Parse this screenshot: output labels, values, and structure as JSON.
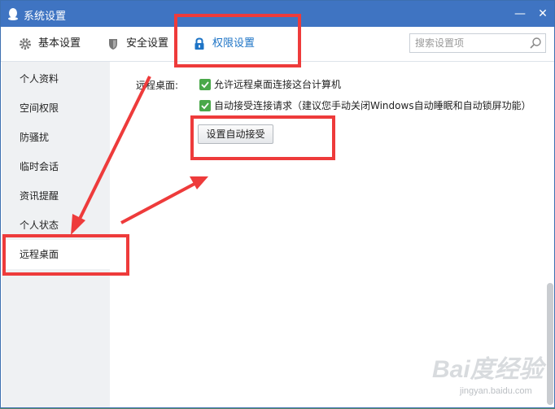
{
  "window": {
    "title": "系统设置",
    "minimize_label": "—",
    "close_label": "✕"
  },
  "tabs": [
    {
      "label": "基本设置",
      "icon": "gear-icon"
    },
    {
      "label": "安全设置",
      "icon": "shield-icon"
    },
    {
      "label": "权限设置",
      "icon": "lock-icon",
      "active": true
    }
  ],
  "search": {
    "placeholder": "搜索设置项"
  },
  "sidebar": {
    "items": [
      {
        "label": "个人资料"
      },
      {
        "label": "空间权限"
      },
      {
        "label": "防骚扰"
      },
      {
        "label": "临时会话"
      },
      {
        "label": "资讯提醒"
      },
      {
        "label": "个人状态"
      },
      {
        "label": "远程桌面",
        "active": true
      }
    ]
  },
  "remote_desktop": {
    "section_label": "远程桌面:",
    "options": [
      {
        "label": "允许远程桌面连接这台计算机",
        "checked": true
      },
      {
        "label": "自动接受连接请求（建议您手动关闭Windows自动睡眠和自动锁屏功能）",
        "checked": true
      }
    ],
    "auto_accept_button": "设置自动接受"
  },
  "watermark": {
    "brand": "Bai度经验",
    "domain": "jingyan.baidu.com"
  },
  "colors": {
    "titlebar": "#3f74c2",
    "accent": "#1e74c6",
    "highlight": "#ee3b3b",
    "check": "#4aa84a"
  }
}
